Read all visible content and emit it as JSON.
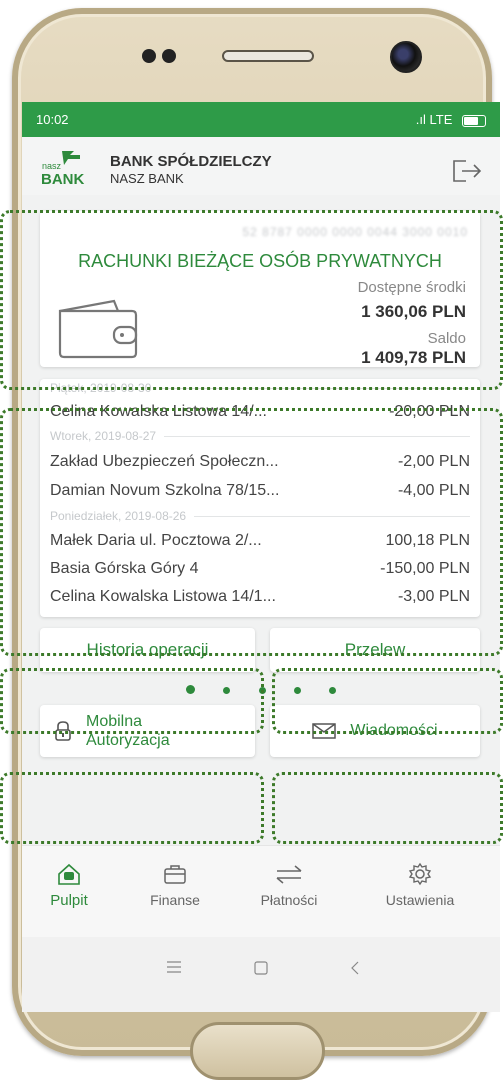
{
  "status_bar": {
    "time": "10:02",
    "signal": ".ıl LTE"
  },
  "header": {
    "logo_top": "nasz",
    "logo_bottom": "BANK",
    "title": "BANK SPÓŁDZIELCZY",
    "subtitle": "NASZ BANK"
  },
  "account": {
    "number_masked": "52 8787 0000 0000 0044 3000 0010",
    "name": "RACHUNKI BIEŻĄCE OSÓB PRYWATNYCH",
    "available_label": "Dostępne środki",
    "available_value": "1 360,06 PLN",
    "balance_label": "Saldo",
    "balance_value": "1 409,78 PLN"
  },
  "history": {
    "groups": [
      {
        "date": "Piątek, 2019-08-30"
      },
      {
        "date": "Wtorek, 2019-08-27"
      },
      {
        "date": "Poniedziałek, 2019-08-26"
      }
    ],
    "transactions": [
      {
        "desc": "Celina Kowalska Listowa 14/...",
        "amount": "-20,00 PLN"
      },
      {
        "desc": "Zakład Ubezpieczeń Społeczn...",
        "amount": "-2,00 PLN"
      },
      {
        "desc": "Damian Novum Szkolna 78/15...",
        "amount": "-4,00 PLN"
      },
      {
        "desc": "Małek Daria  ul. Pocztowa 2/...",
        "amount": "100,18 PLN"
      },
      {
        "desc": "Basia Górska Góry 4",
        "amount": "-150,00 PLN"
      },
      {
        "desc": "Celina Kowalska Listowa 14/1...",
        "amount": "-3,00 PLN"
      }
    ]
  },
  "actions": {
    "history_label": "Historia operacji",
    "transfer_label": "Przelew",
    "mobile_auth_line1": "Mobilna",
    "mobile_auth_line2": "Autoryzacja",
    "messages_label": "Wiadomości"
  },
  "tabs": [
    {
      "label": "Pulpit"
    },
    {
      "label": "Finanse"
    },
    {
      "label": "Płatności"
    },
    {
      "label": "Ustawienia"
    }
  ],
  "colors": {
    "accent": "#2e8a3c",
    "status_bar": "#2e9b48",
    "highlight": "#3d7a2a"
  }
}
